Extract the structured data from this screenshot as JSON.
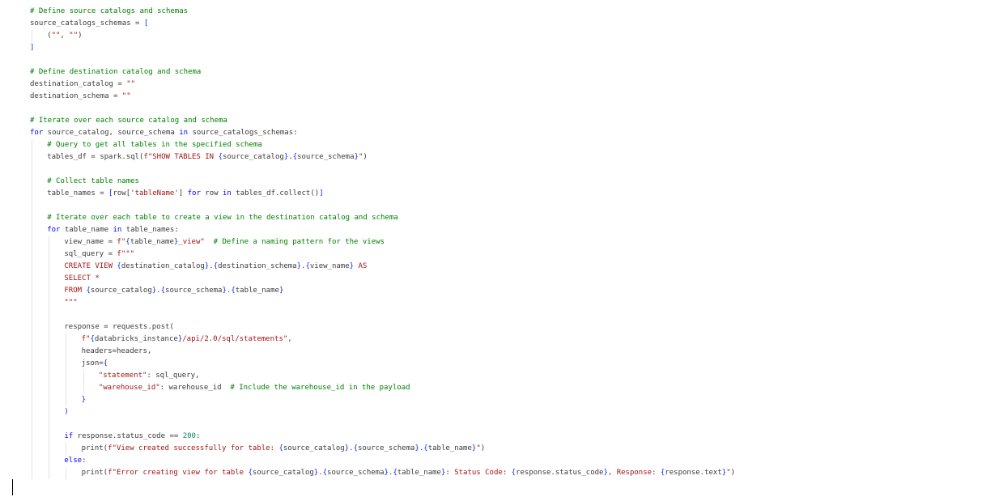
{
  "editor": {
    "language": "python",
    "lines": [
      {
        "indent": 0,
        "tokens": [
          {
            "t": "# Define source catalogs and schemas",
            "c": "c"
          }
        ]
      },
      {
        "indent": 0,
        "tokens": [
          {
            "t": "source_catalogs_schemas = ",
            "c": ""
          },
          {
            "t": "[",
            "c": "p"
          }
        ]
      },
      {
        "indent": 1,
        "tokens": [
          {
            "t": "(",
            "c": ""
          },
          {
            "t": "\"\"",
            "c": "s"
          },
          {
            "t": ", ",
            "c": ""
          },
          {
            "t": "\"\"",
            "c": "s"
          },
          {
            "t": ")",
            "c": ""
          }
        ]
      },
      {
        "indent": 0,
        "tokens": [
          {
            "t": "]",
            "c": "p"
          }
        ]
      },
      {
        "indent": 0,
        "tokens": []
      },
      {
        "indent": 0,
        "tokens": [
          {
            "t": "# Define destination catalog and schema",
            "c": "c"
          }
        ]
      },
      {
        "indent": 0,
        "tokens": [
          {
            "t": "destination_catalog = ",
            "c": ""
          },
          {
            "t": "\"\"",
            "c": "s"
          }
        ]
      },
      {
        "indent": 0,
        "tokens": [
          {
            "t": "destination_schema = ",
            "c": ""
          },
          {
            "t": "\"\"",
            "c": "s"
          }
        ]
      },
      {
        "indent": 0,
        "tokens": []
      },
      {
        "indent": 0,
        "tokens": [
          {
            "t": "# Iterate over each source catalog and schema",
            "c": "c"
          }
        ]
      },
      {
        "indent": 0,
        "tokens": [
          {
            "t": "for",
            "c": "k"
          },
          {
            "t": " source_catalog, source_schema ",
            "c": ""
          },
          {
            "t": "in",
            "c": "k"
          },
          {
            "t": " source_catalogs_schemas:",
            "c": ""
          }
        ]
      },
      {
        "indent": 1,
        "tokens": [
          {
            "t": "# Query to get all tables in the specified schema",
            "c": "c"
          }
        ]
      },
      {
        "indent": 1,
        "tokens": [
          {
            "t": "tables_df = spark.sql(",
            "c": ""
          },
          {
            "t": "f\"SHOW TABLES IN ",
            "c": "s"
          },
          {
            "t": "{",
            "c": "p"
          },
          {
            "t": "source_catalog",
            "c": ""
          },
          {
            "t": "}",
            "c": "p"
          },
          {
            "t": ".",
            "c": "s"
          },
          {
            "t": "{",
            "c": "p"
          },
          {
            "t": "source_schema",
            "c": ""
          },
          {
            "t": "}",
            "c": "p"
          },
          {
            "t": "\"",
            "c": "s"
          },
          {
            "t": ")",
            "c": ""
          }
        ]
      },
      {
        "indent": 1,
        "tokens": []
      },
      {
        "indent": 1,
        "tokens": [
          {
            "t": "# Collect table names",
            "c": "c"
          }
        ]
      },
      {
        "indent": 1,
        "tokens": [
          {
            "t": "table_names = ",
            "c": ""
          },
          {
            "t": "[",
            "c": "p"
          },
          {
            "t": "row[",
            "c": ""
          },
          {
            "t": "'tableName'",
            "c": "s"
          },
          {
            "t": "] ",
            "c": ""
          },
          {
            "t": "for",
            "c": "k"
          },
          {
            "t": " row ",
            "c": ""
          },
          {
            "t": "in",
            "c": "k"
          },
          {
            "t": " tables_df.collect()",
            "c": ""
          },
          {
            "t": "]",
            "c": "p"
          }
        ]
      },
      {
        "indent": 1,
        "tokens": []
      },
      {
        "indent": 1,
        "tokens": [
          {
            "t": "# Iterate over each table to create a view in the destination catalog and schema",
            "c": "c"
          }
        ]
      },
      {
        "indent": 1,
        "tokens": [
          {
            "t": "for",
            "c": "k"
          },
          {
            "t": " table_name ",
            "c": ""
          },
          {
            "t": "in",
            "c": "k"
          },
          {
            "t": " table_names:",
            "c": ""
          }
        ]
      },
      {
        "indent": 2,
        "tokens": [
          {
            "t": "view_name = ",
            "c": ""
          },
          {
            "t": "f\"",
            "c": "s"
          },
          {
            "t": "{",
            "c": "p"
          },
          {
            "t": "table_name",
            "c": ""
          },
          {
            "t": "}",
            "c": "p"
          },
          {
            "t": "_view\"",
            "c": "s"
          },
          {
            "t": "  ",
            "c": ""
          },
          {
            "t": "# Define a naming pattern for the views",
            "c": "c"
          }
        ]
      },
      {
        "indent": 2,
        "tokens": [
          {
            "t": "sql_query = ",
            "c": ""
          },
          {
            "t": "f\"\"\"",
            "c": "s"
          }
        ]
      },
      {
        "indent": 2,
        "tokens": [
          {
            "t": "CREATE VIEW ",
            "c": "s"
          },
          {
            "t": "{",
            "c": "p"
          },
          {
            "t": "destination_catalog",
            "c": ""
          },
          {
            "t": "}",
            "c": "p"
          },
          {
            "t": ".",
            "c": "s"
          },
          {
            "t": "{",
            "c": "p"
          },
          {
            "t": "destination_schema",
            "c": ""
          },
          {
            "t": "}",
            "c": "p"
          },
          {
            "t": ".",
            "c": "s"
          },
          {
            "t": "{",
            "c": "p"
          },
          {
            "t": "view_name",
            "c": ""
          },
          {
            "t": "}",
            "c": "p"
          },
          {
            "t": " AS",
            "c": "s"
          }
        ]
      },
      {
        "indent": 2,
        "tokens": [
          {
            "t": "SELECT *",
            "c": "s"
          }
        ]
      },
      {
        "indent": 2,
        "tokens": [
          {
            "t": "FROM ",
            "c": "s"
          },
          {
            "t": "{",
            "c": "p"
          },
          {
            "t": "source_catalog",
            "c": ""
          },
          {
            "t": "}",
            "c": "p"
          },
          {
            "t": ".",
            "c": "s"
          },
          {
            "t": "{",
            "c": "p"
          },
          {
            "t": "source_schema",
            "c": ""
          },
          {
            "t": "}",
            "c": "p"
          },
          {
            "t": ".",
            "c": "s"
          },
          {
            "t": "{",
            "c": "p"
          },
          {
            "t": "table_name",
            "c": ""
          },
          {
            "t": "}",
            "c": "p"
          }
        ]
      },
      {
        "indent": 2,
        "tokens": [
          {
            "t": "\"\"\"",
            "c": "s"
          }
        ]
      },
      {
        "indent": 2,
        "tokens": []
      },
      {
        "indent": 2,
        "tokens": [
          {
            "t": "response = requests.post(",
            "c": ""
          }
        ]
      },
      {
        "indent": 3,
        "tokens": [
          {
            "t": "f\"",
            "c": "s"
          },
          {
            "t": "{",
            "c": "p"
          },
          {
            "t": "databricks_instance",
            "c": ""
          },
          {
            "t": "}",
            "c": "p"
          },
          {
            "t": "/api/2.0/sql/statements\"",
            "c": "s"
          },
          {
            "t": ",",
            "c": ""
          }
        ]
      },
      {
        "indent": 3,
        "tokens": [
          {
            "t": "headers=headers,",
            "c": ""
          }
        ]
      },
      {
        "indent": 3,
        "tokens": [
          {
            "t": "json=",
            "c": ""
          },
          {
            "t": "{",
            "c": "p"
          }
        ]
      },
      {
        "indent": 4,
        "tokens": [
          {
            "t": "\"statement\"",
            "c": "s"
          },
          {
            "t": ": sql_query,",
            "c": ""
          }
        ]
      },
      {
        "indent": 4,
        "tokens": [
          {
            "t": "\"warehouse_id\"",
            "c": "s"
          },
          {
            "t": ": warehouse_id  ",
            "c": ""
          },
          {
            "t": "# Include the warehouse_id in the payload",
            "c": "c"
          }
        ]
      },
      {
        "indent": 3,
        "tokens": [
          {
            "t": "}",
            "c": "p"
          }
        ]
      },
      {
        "indent": 2,
        "tokens": [
          {
            "t": ")",
            "c": "p"
          }
        ]
      },
      {
        "indent": 2,
        "tokens": []
      },
      {
        "indent": 2,
        "tokens": [
          {
            "t": "if",
            "c": "k"
          },
          {
            "t": " response.status_code == ",
            "c": ""
          },
          {
            "t": "200",
            "c": "n"
          },
          {
            "t": ":",
            "c": ""
          }
        ]
      },
      {
        "indent": 3,
        "tokens": [
          {
            "t": "print(",
            "c": ""
          },
          {
            "t": "f\"View created successfully for table: ",
            "c": "s"
          },
          {
            "t": "{",
            "c": "p"
          },
          {
            "t": "source_catalog",
            "c": ""
          },
          {
            "t": "}",
            "c": "p"
          },
          {
            "t": ".",
            "c": "s"
          },
          {
            "t": "{",
            "c": "p"
          },
          {
            "t": "source_schema",
            "c": ""
          },
          {
            "t": "}",
            "c": "p"
          },
          {
            "t": ".",
            "c": "s"
          },
          {
            "t": "{",
            "c": "p"
          },
          {
            "t": "table_name",
            "c": ""
          },
          {
            "t": "}",
            "c": "p"
          },
          {
            "t": "\"",
            "c": "s"
          },
          {
            "t": ")",
            "c": ""
          }
        ]
      },
      {
        "indent": 2,
        "tokens": [
          {
            "t": "else",
            "c": "k"
          },
          {
            "t": ":",
            "c": ""
          }
        ]
      },
      {
        "indent": 3,
        "tokens": [
          {
            "t": "print(",
            "c": ""
          },
          {
            "t": "f\"Error creating view for table ",
            "c": "s"
          },
          {
            "t": "{",
            "c": "p"
          },
          {
            "t": "source_catalog",
            "c": ""
          },
          {
            "t": "}",
            "c": "p"
          },
          {
            "t": ".",
            "c": "s"
          },
          {
            "t": "{",
            "c": "p"
          },
          {
            "t": "source_schema",
            "c": ""
          },
          {
            "t": "}",
            "c": "p"
          },
          {
            "t": ".",
            "c": "s"
          },
          {
            "t": "{",
            "c": "p"
          },
          {
            "t": "table_name",
            "c": ""
          },
          {
            "t": "}",
            "c": "p"
          },
          {
            "t": ": Status Code: ",
            "c": "s"
          },
          {
            "t": "{",
            "c": "p"
          },
          {
            "t": "response.status_code",
            "c": ""
          },
          {
            "t": "}",
            "c": "p"
          },
          {
            "t": ", Response: ",
            "c": "s"
          },
          {
            "t": "{",
            "c": "p"
          },
          {
            "t": "response.text",
            "c": ""
          },
          {
            "t": "}",
            "c": "p"
          },
          {
            "t": "\"",
            "c": "s"
          },
          {
            "t": ")",
            "c": ""
          }
        ]
      }
    ]
  }
}
